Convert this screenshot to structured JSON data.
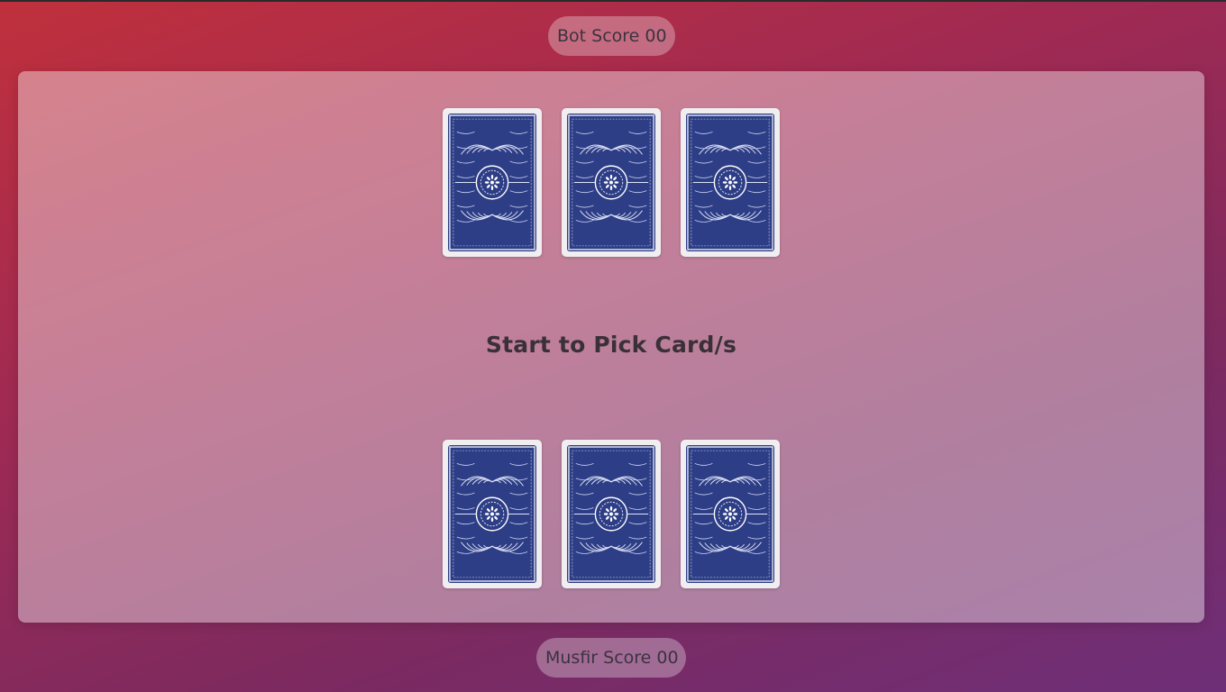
{
  "scores": {
    "bot": "Bot Score 00",
    "player": "Musfir Score 00"
  },
  "status_message": "Start to Pick Card/s",
  "bot_hand": [
    {
      "face": "card-back"
    },
    {
      "face": "card-back"
    },
    {
      "face": "card-back"
    }
  ],
  "player_hand": [
    {
      "face": "card-back"
    },
    {
      "face": "card-back"
    },
    {
      "face": "card-back"
    }
  ],
  "colors": {
    "card_back": "#2e3e86",
    "card_border": "#f1eef2",
    "background_start": "#c0303c",
    "background_end": "#6e2f78"
  }
}
